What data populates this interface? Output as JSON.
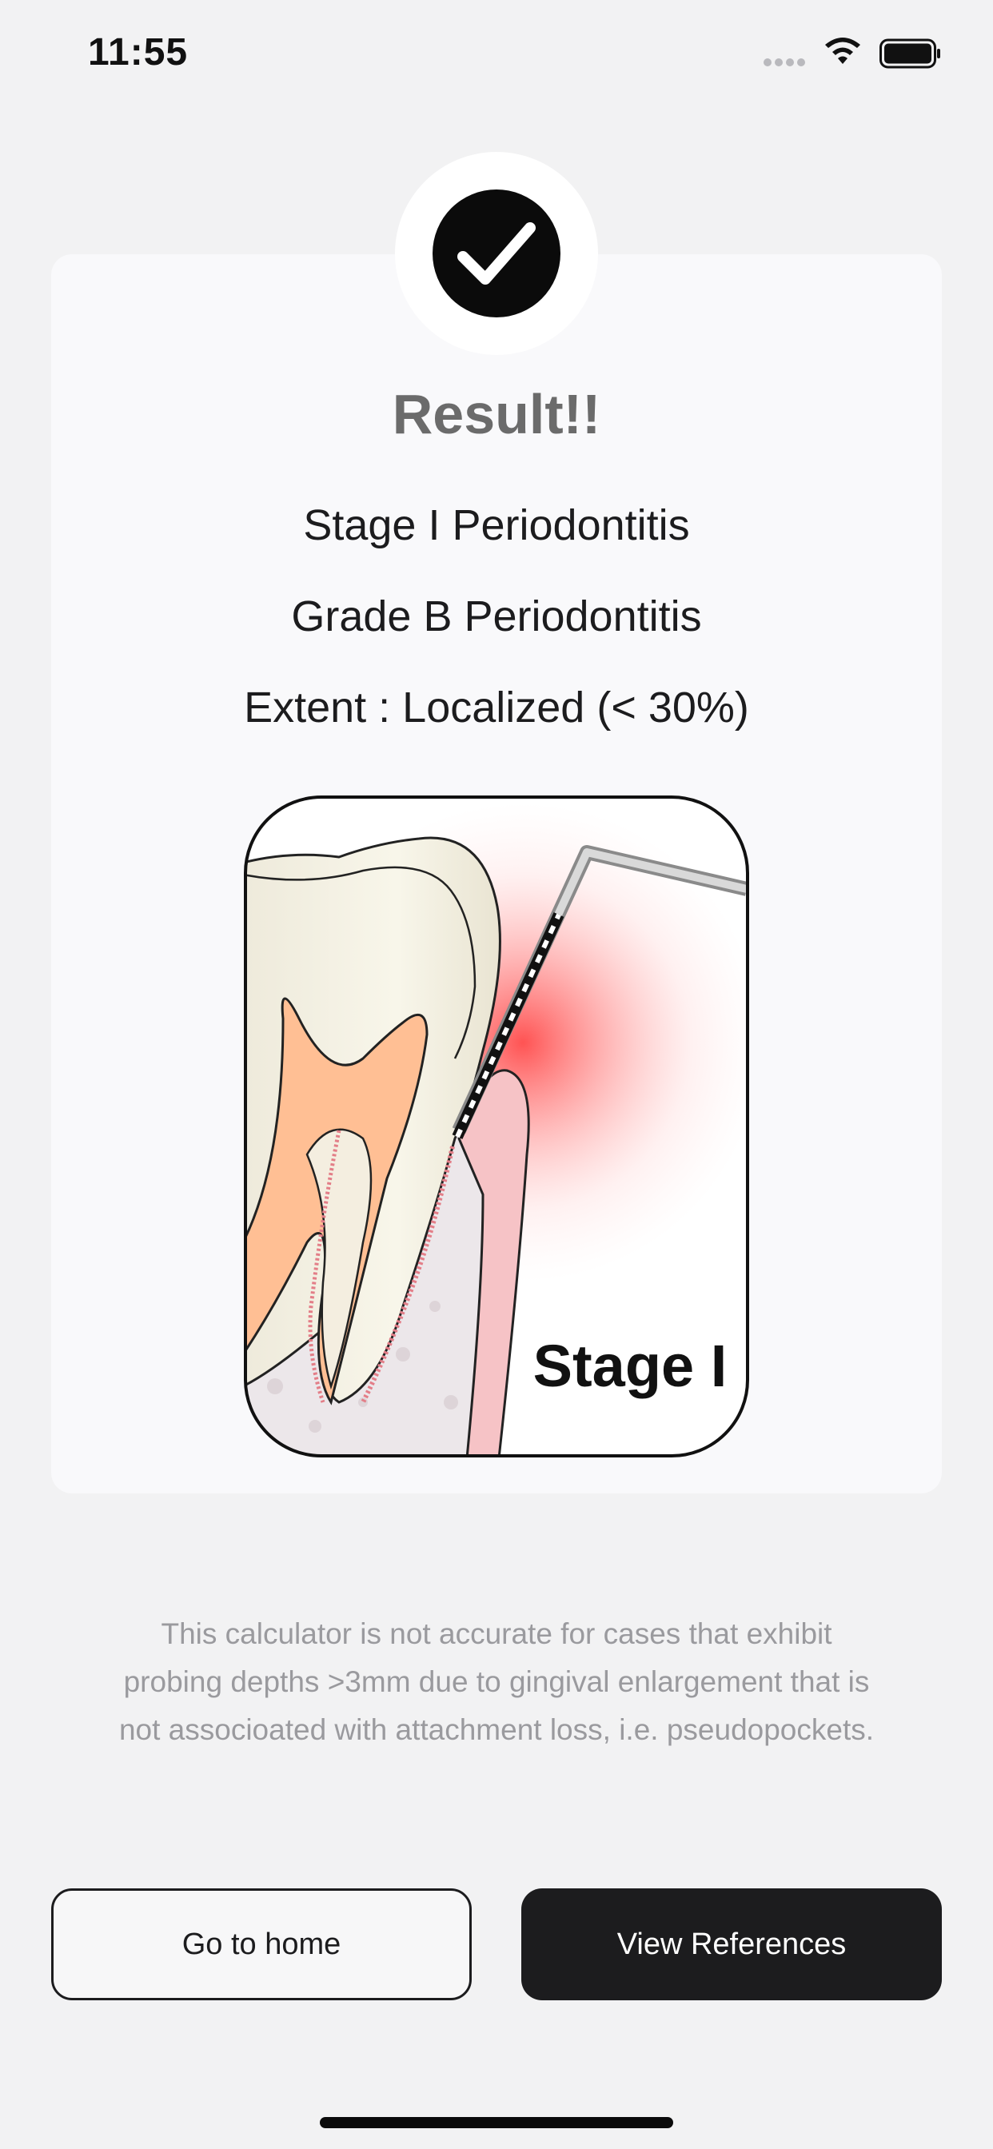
{
  "status_bar": {
    "time": "11:55"
  },
  "card": {
    "title": "Result!!",
    "stage": "Stage I Periodontitis",
    "grade": "Grade B Periodontitis",
    "extent": "Extent :  Localized (< 30%)",
    "illustration_label": "Stage I"
  },
  "disclaimer": {
    "line1": "This calculator is not accurate for cases that exhibit",
    "line2": "probing depths >3mm due to gingival enlargement that is",
    "line3": "not associoated with attachment loss, i.e. pseudopockets."
  },
  "buttons": {
    "home_label": "Go to home",
    "references_label": "View References"
  },
  "colors": {
    "background": "#f2f2f3",
    "card": "#f9f9fb",
    "primary_button": "#1c1c1e",
    "title": "#6b6b6b",
    "disclaimer": "#9a9a9e",
    "inflammation": "#ff4a4a"
  },
  "icons": [
    "signal-dots-icon",
    "wifi-icon",
    "battery-icon",
    "checkmark-icon"
  ]
}
